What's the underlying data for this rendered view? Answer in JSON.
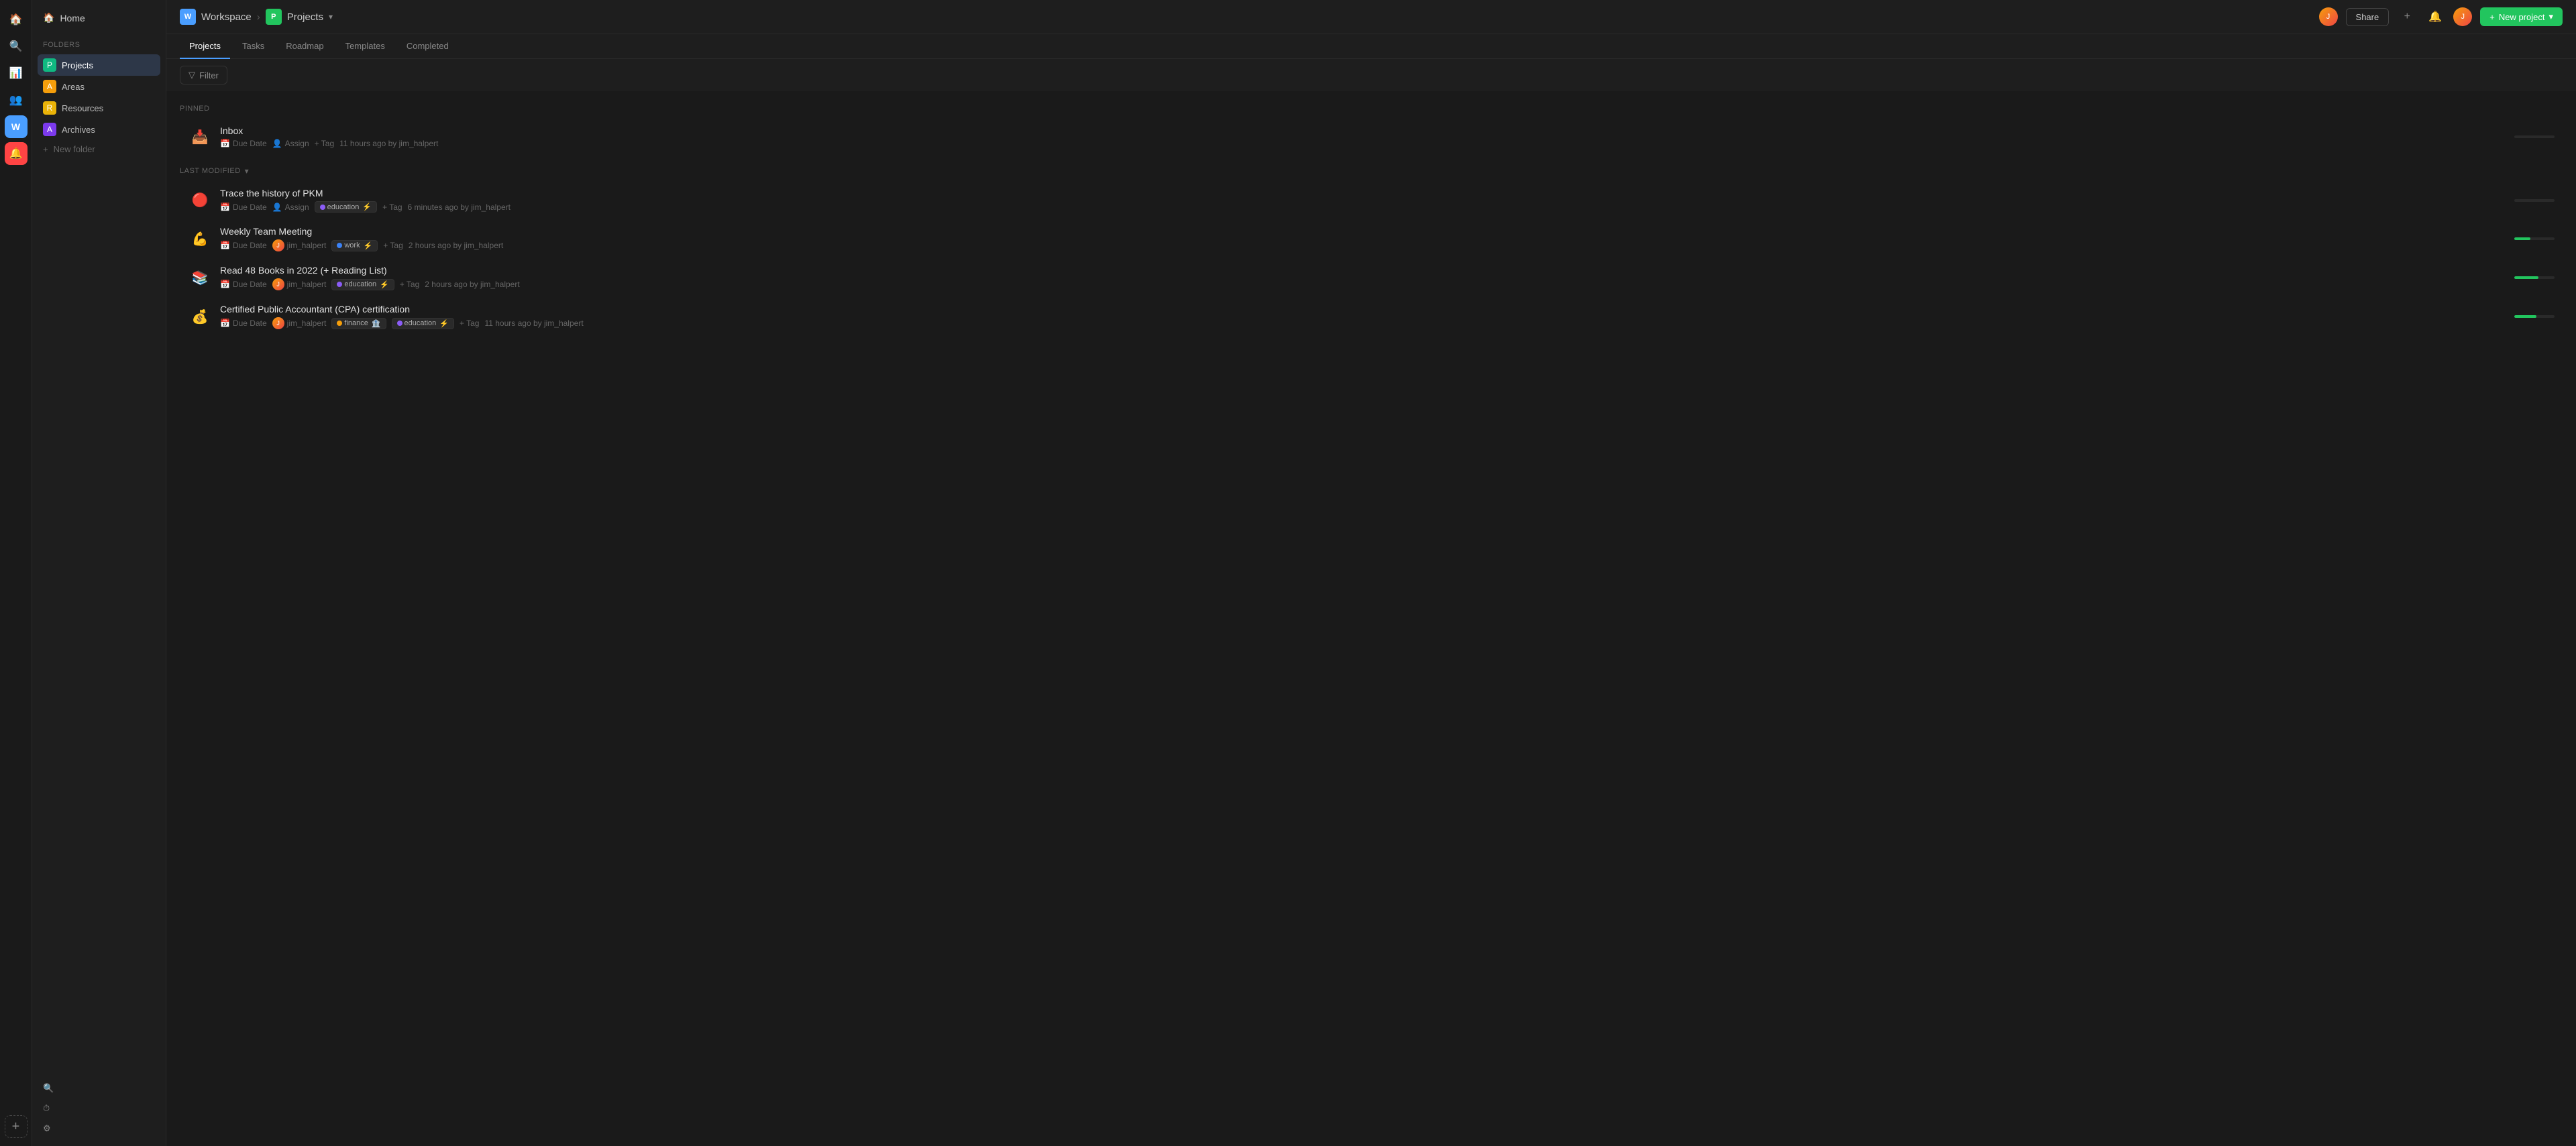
{
  "app": {
    "workspace_label": "W",
    "workspace_name": "Workspace"
  },
  "topbar": {
    "breadcrumb": {
      "workspace_icon": "W",
      "workspace_name": "Workspace",
      "projects_icon": "P",
      "projects_name": "Projects",
      "dropdown_icon": "▾"
    },
    "share_label": "Share",
    "new_project_label": "New project"
  },
  "tabs": [
    {
      "id": "projects",
      "label": "Projects",
      "active": true
    },
    {
      "id": "tasks",
      "label": "Tasks",
      "active": false
    },
    {
      "id": "roadmap",
      "label": "Roadmap",
      "active": false
    },
    {
      "id": "templates",
      "label": "Templates",
      "active": false
    },
    {
      "id": "completed",
      "label": "Completed",
      "active": false
    }
  ],
  "filter": {
    "label": "Filter"
  },
  "sidebar": {
    "home_label": "Home",
    "folders_label": "FOLDERS",
    "items": [
      {
        "id": "projects",
        "label": "Projects",
        "icon": "P",
        "color": "green",
        "active": true
      },
      {
        "id": "areas",
        "label": "Areas",
        "icon": "A",
        "color": "orange"
      },
      {
        "id": "resources",
        "label": "Resources",
        "icon": "R",
        "color": "yellow"
      },
      {
        "id": "archives",
        "label": "Archives",
        "icon": "A",
        "color": "purple"
      }
    ],
    "new_folder_label": "New folder",
    "bottom": [
      {
        "id": "search",
        "label": "Search",
        "icon": "🔍"
      },
      {
        "id": "history",
        "label": "History",
        "icon": "⏱"
      },
      {
        "id": "settings",
        "label": "Settings",
        "icon": "⚙"
      }
    ]
  },
  "pinned_section": {
    "label": "PINNED",
    "item": {
      "name": "Inbox",
      "emoji": "📥",
      "due_date": "Due Date",
      "assign": "Assign",
      "tag": "+ Tag",
      "timestamp": "11 hours ago by jim_halpert",
      "progress": 0
    }
  },
  "last_modified_section": {
    "label": "LAST MODIFIED",
    "sort_icon": "▾",
    "items": [
      {
        "id": 1,
        "name": "Trace the history of PKM",
        "emoji": "🔴",
        "due_date": "Due Date",
        "assign": "Assign",
        "tag_label": "education",
        "tag_dot": "purple",
        "add_tag": "+ Tag",
        "timestamp": "6 minutes ago by jim_halpert",
        "progress_value": 0,
        "progress_color": "#555"
      },
      {
        "id": 2,
        "name": "Weekly Team Meeting",
        "emoji": "💪",
        "due_date": "Due Date",
        "user": "jim_halpert",
        "tag_label": "work",
        "tag_dot": "blue",
        "add_tag": "+ Tag",
        "timestamp": "2 hours ago by jim_halpert",
        "progress_value": 40,
        "progress_color": "#22c55e"
      },
      {
        "id": 3,
        "name": "Read 48 Books in 2022 (+ Reading List)",
        "emoji": "📚",
        "due_date": "Due Date",
        "user": "jim_halpert",
        "tag_label": "education",
        "tag_dot": "purple",
        "add_tag": "+ Tag",
        "timestamp": "2 hours ago by jim_halpert",
        "progress_value": 60,
        "progress_color": "#22c55e"
      },
      {
        "id": 4,
        "name": "Certified Public Accountant (CPA) certification",
        "emoji": "💰",
        "due_date": "Due Date",
        "user": "jim_halpert",
        "tag_label1": "finance",
        "tag_dot1": "orange",
        "tag_label2": "education",
        "tag_dot2": "purple",
        "add_tag": "+ Tag",
        "timestamp": "11 hours ago by jim_halpert",
        "progress_value": 55,
        "progress_color": "#22c55e"
      }
    ]
  }
}
